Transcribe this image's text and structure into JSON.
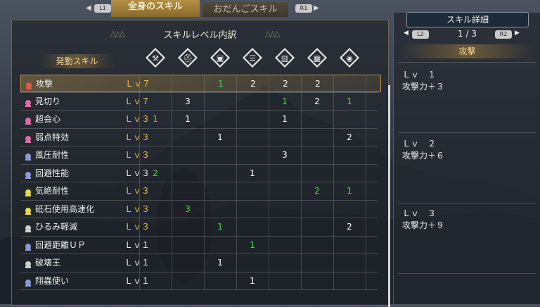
{
  "tabs": {
    "l_button": "L1",
    "r_button": "R1",
    "active": "全身のスキル",
    "inactive": "おだんごスキル"
  },
  "panel": {
    "title": "スキルレベル内訳",
    "header_label": "発動スキル",
    "decor_icons": [
      "weapon-icon",
      "helm-icon",
      "chest-icon",
      "arm-icon",
      "waist-icon",
      "leg-icon",
      "talisman-icon"
    ]
  },
  "skills": [
    {
      "name": "攻撃",
      "level": "Ｌｖ７",
      "icon_color": "#e05a4a",
      "lv_color": "#f2c04a",
      "cells": [
        "",
        "",
        "1",
        "2",
        "2",
        "2",
        ""
      ],
      "cell_colors": [
        "",
        "",
        "#3ee03a",
        "#ffffff",
        "#ffffff",
        "#ffffff",
        ""
      ],
      "selected": true
    },
    {
      "name": "見切り",
      "level": "Ｌｖ７",
      "icon_color": "#e06aa8",
      "lv_color": "#f2c04a",
      "cells": [
        "",
        "3",
        "",
        "",
        "1",
        "2",
        "1"
      ],
      "cell_colors": [
        "",
        "#ffffff",
        "",
        "",
        "#3ee03a",
        "#ffffff",
        "#3ee03a"
      ],
      "selected": false
    },
    {
      "name": "超会心",
      "level": "Ｌｖ３",
      "icon_color": "#e06aa8",
      "lv_color": "#f2c04a",
      "cells": [
        "1",
        "1",
        "",
        "",
        "1",
        "",
        ""
      ],
      "cell_colors": [
        "#3ee03a",
        "#ffffff",
        "",
        "",
        "#ffffff",
        "",
        ""
      ],
      "selected": false
    },
    {
      "name": "弱点特効",
      "level": "Ｌｖ３",
      "icon_color": "#e06aa8",
      "lv_color": "#f2c04a",
      "cells": [
        "",
        "",
        "1",
        "",
        "",
        "",
        "2"
      ],
      "cell_colors": [
        "",
        "",
        "#ffffff",
        "",
        "",
        "",
        "#ffffff"
      ],
      "selected": false
    },
    {
      "name": "風圧耐性",
      "level": "Ｌｖ３",
      "icon_color": "#8a9ad8",
      "lv_color": "#f2c04a",
      "cells": [
        "",
        "",
        "",
        "",
        "3",
        "",
        ""
      ],
      "cell_colors": [
        "",
        "",
        "",
        "",
        "#ffffff",
        "",
        ""
      ],
      "selected": false
    },
    {
      "name": "回避性能",
      "level": "Ｌｖ３",
      "icon_color": "#8a9ad8",
      "lv_color": "#eeeeee",
      "cells": [
        "2",
        "",
        "",
        "1",
        "",
        "",
        ""
      ],
      "cell_colors": [
        "#3ee03a",
        "",
        "",
        "#ffffff",
        "",
        "",
        ""
      ],
      "selected": false
    },
    {
      "name": "気絶耐性",
      "level": "Ｌｖ３",
      "icon_color": "#e8d84a",
      "lv_color": "#f2c04a",
      "cells": [
        "",
        "",
        "",
        "",
        "",
        "2",
        "1"
      ],
      "cell_colors": [
        "",
        "",
        "",
        "",
        "",
        "#3ee03a",
        "#3ee03a"
      ],
      "selected": false
    },
    {
      "name": "砥石使用高速化",
      "level": "Ｌｖ３",
      "icon_color": "#e8d84a",
      "lv_color": "#f2c04a",
      "cells": [
        "",
        "3",
        "",
        "",
        "",
        "",
        ""
      ],
      "cell_colors": [
        "",
        "#3ee03a",
        "",
        "",
        "",
        "",
        ""
      ],
      "selected": false
    },
    {
      "name": "ひるみ軽減",
      "level": "Ｌｖ３",
      "icon_color": "#cfcfcf",
      "lv_color": "#f2c04a",
      "cells": [
        "",
        "",
        "1",
        "",
        "",
        "",
        "2"
      ],
      "cell_colors": [
        "",
        "",
        "#3ee03a",
        "",
        "",
        "",
        "#ffffff"
      ],
      "selected": false
    },
    {
      "name": "回避距離ＵＰ",
      "level": "Ｌｖ１",
      "icon_color": "#8a9ad8",
      "lv_color": "#eeeeee",
      "cells": [
        "",
        "",
        "",
        "1",
        "",
        "",
        ""
      ],
      "cell_colors": [
        "",
        "",
        "",
        "#3ee03a",
        "",
        "",
        ""
      ],
      "selected": false
    },
    {
      "name": "破壊王",
      "level": "Ｌｖ１",
      "icon_color": "#cfcfcf",
      "lv_color": "#eeeeee",
      "cells": [
        "",
        "",
        "1",
        "",
        "",
        "",
        ""
      ],
      "cell_colors": [
        "",
        "",
        "#ffffff",
        "",
        "",
        "",
        ""
      ],
      "selected": false
    },
    {
      "name": "翔蟲使い",
      "level": "Ｌｖ１",
      "icon_color": "#8a9ad8",
      "lv_color": "#eeeeee",
      "cells": [
        "",
        "",
        "",
        "1",
        "",
        "",
        ""
      ],
      "cell_colors": [
        "",
        "",
        "",
        "#ffffff",
        "",
        "",
        ""
      ],
      "selected": false
    }
  ],
  "detail": {
    "title": "スキル詳細",
    "l_button": "L2",
    "r_button": "R2",
    "page": "1 / 3",
    "skill": "攻撃",
    "levels": [
      {
        "lv": "Ｌｖ　１",
        "desc": "攻撃力＋３"
      },
      {
        "lv": "Ｌｖ　２",
        "desc": "攻撃力＋６"
      },
      {
        "lv": "Ｌｖ　３",
        "desc": "攻撃力＋９"
      }
    ]
  }
}
